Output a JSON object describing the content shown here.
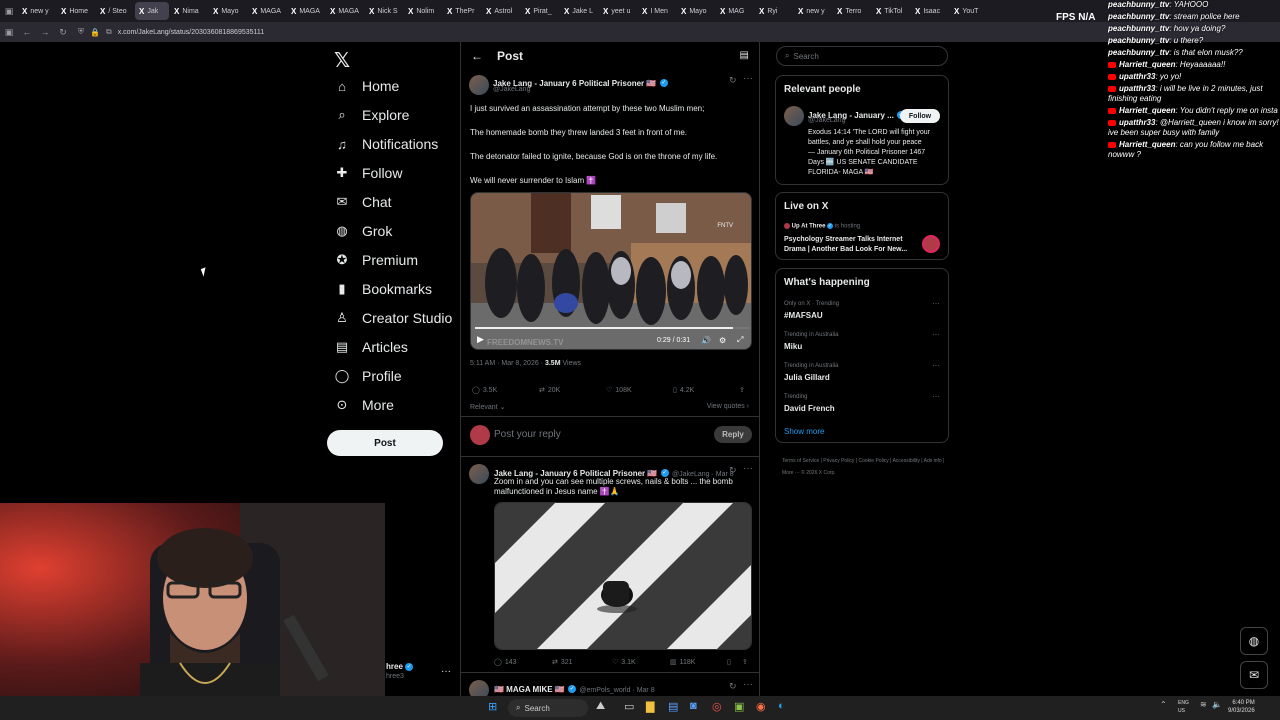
{
  "browser": {
    "tabs": [
      {
        "icon": "X",
        "label": "new y"
      },
      {
        "icon": "X",
        "label": "Home"
      },
      {
        "icon": "X",
        "label": "/ Steo"
      },
      {
        "icon": "X",
        "label": "Jak",
        "active": true
      },
      {
        "icon": "X",
        "label": "Nima"
      },
      {
        "icon": "X",
        "label": "Mayo"
      },
      {
        "icon": "X",
        "label": "MAGA"
      },
      {
        "icon": "X",
        "label": "MAGA"
      },
      {
        "icon": "X",
        "label": "MAGA"
      },
      {
        "icon": "X",
        "label": "Nick S"
      },
      {
        "icon": "X",
        "label": "Nolim"
      },
      {
        "icon": "X",
        "label": "ThePr"
      },
      {
        "icon": "X",
        "label": "Astrol"
      },
      {
        "icon": "X",
        "label": "Pirat_"
      },
      {
        "icon": "X",
        "label": "Jake L"
      },
      {
        "icon": "X",
        "label": "yeet u"
      },
      {
        "icon": "X",
        "label": "I Men"
      },
      {
        "icon": "X",
        "label": "Mayo"
      },
      {
        "icon": "X",
        "label": "MAG"
      },
      {
        "icon": "X",
        "label": "Ryi"
      },
      {
        "icon": "X",
        "label": "new y"
      },
      {
        "icon": "X",
        "label": "Terro"
      },
      {
        "icon": "X",
        "label": "TikTol"
      },
      {
        "icon": "X",
        "label": "Isaac"
      },
      {
        "icon": "X",
        "label": "YouT"
      }
    ],
    "url": "x.com/JakeLang/status/2030360818869535111"
  },
  "nav": {
    "items": [
      {
        "label": "Home",
        "icon": "⌂"
      },
      {
        "label": "Explore",
        "icon": "⌕"
      },
      {
        "label": "Notifications",
        "icon": "♫"
      },
      {
        "label": "Follow",
        "icon": "✚"
      },
      {
        "label": "Chat",
        "icon": "✉"
      },
      {
        "label": "Grok",
        "icon": "◍"
      },
      {
        "label": "Premium",
        "icon": "✪"
      },
      {
        "label": "Bookmarks",
        "icon": "▮"
      },
      {
        "label": "Creator Studio",
        "icon": "♙"
      },
      {
        "label": "Articles",
        "icon": "▤"
      },
      {
        "label": "Profile",
        "icon": "◯"
      },
      {
        "label": "More",
        "icon": "⊙"
      }
    ],
    "post_label": "Post"
  },
  "header": {
    "title": "Post"
  },
  "post": {
    "author": "Jake Lang - January 6 Political Prisoner 🇺🇸",
    "handle": "@JakeLang",
    "lines": [
      "I just survived an assassination attempt by these two Muslim men;",
      "The homemade bomb they threw landed 3 feet in front of me.",
      "The detonator failed to ignite, because God is on the throne of my life.",
      " We will never surrender to Islam ✝️"
    ],
    "video": {
      "watermark": "FREEDOMNEWS.TV",
      "badge": "FNTV",
      "time": "0:29 / 0:31",
      "progress": 0.94
    },
    "time": "5:11 AM · Mar 8, 2026 · ",
    "views": "3.5M",
    "views_label": " Views",
    "stats": {
      "replies": "3.5K",
      "reposts": "20K",
      "likes": "108K",
      "bookmarks": "4.2K"
    },
    "relevant": "Relevant ⌄",
    "view_quotes": "View quotes ›"
  },
  "reply": {
    "placeholder": "Post your reply",
    "button": "Reply"
  },
  "reply_post": {
    "author": "Jake Lang - January 6 Political Prisoner 🇺🇸",
    "handle": "@JakeLang · Mar 8",
    "lines": [
      "Zoom in and you can see multiple screws, nails & bolts ... the bomb",
      "malfunctioned in Jesus name ✝️🙏"
    ],
    "stats": {
      "replies": "143",
      "reposts": "321",
      "likes": "3.1K",
      "views": "118K"
    }
  },
  "third_post": {
    "author": "🇺🇸 MAGA MIKE 🇺🇸",
    "handle": "@emPols_world · Mar 8"
  },
  "right": {
    "search_placeholder": "Search",
    "relevant_title": "Relevant people",
    "person": {
      "name": "Jake Lang - January ...",
      "handle": "@JakeLang",
      "follow": "Follow",
      "bio": [
        "Exodus 14:14 'The LORD will fight your",
        "battles, and ye shall hold your peace",
        "— January 6th Political Prisoner 1467",
        "Days 🆕 US SENATE CANDIDATE",
        "FLORIDA- MAGA 🇺🇸"
      ]
    },
    "live_title": "Live on X",
    "live": {
      "host": "Up At Three",
      "hosting": " is hosting",
      "title1": "Psychology Streamer Talks Internet",
      "title2": "Drama | Another Bad Look For New..."
    },
    "happening_title": "What's happening",
    "trends": [
      {
        "meta": "Only on X · Trending",
        "name": "#MAFSAU"
      },
      {
        "meta": "Trending in Australia",
        "name": "Miku"
      },
      {
        "meta": "Trending in Australia",
        "name": "Julia Gillard"
      },
      {
        "meta": "Trending",
        "name": "David French"
      }
    ],
    "show_more": "Show more",
    "footer": "Terms of Service  |  Privacy Policy  |  Cookie Policy  |  Accessibility  |  Ads info  |  More ···  © 2026 X Corp."
  },
  "overlay": {
    "fps": "FPS N/A",
    "chat": [
      {
        "user": "peachbunny_ttv",
        "text": "YAHOOO",
        "yt": false
      },
      {
        "user": "peachbunny_ttv",
        "text": "stream police here",
        "yt": false
      },
      {
        "user": "peachbunny_ttv",
        "text": "how ya doing?",
        "yt": false
      },
      {
        "user": "peachbunny_ttv",
        "text": "u there?",
        "yt": false
      },
      {
        "user": "peachbunny_ttv",
        "text": "is that elon musk??",
        "yt": false
      },
      {
        "user": "Harriett_queen",
        "text": "Heyaaaaaa!!",
        "yt": true
      },
      {
        "user": "upatthr33",
        "text": "yo yo!",
        "yt": true
      },
      {
        "user": "upatthr33",
        "text": "i will be live in 2 minutes, just finishing eating",
        "yt": true
      },
      {
        "user": "Harriett_queen",
        "text": "You didn't reply me on insta",
        "yt": true
      },
      {
        "user": "upatthr33",
        "text": "@Harriett_queen i know im sorry! ive been super busy with family",
        "yt": true
      },
      {
        "user": "Harriett_queen",
        "text": "can you follow me back nowww ?",
        "yt": true
      }
    ],
    "webcam_label_name": "hree",
    "webcam_label_handle": "hree3"
  },
  "taskbar": {
    "search": "Search",
    "lang1": "ENG",
    "lang2": "US",
    "time": "6:40 PM",
    "date": "9/03/2026"
  },
  "colors": {
    "accent": "#1d9bf0",
    "bg": "#000000",
    "border": "#2f3336"
  }
}
